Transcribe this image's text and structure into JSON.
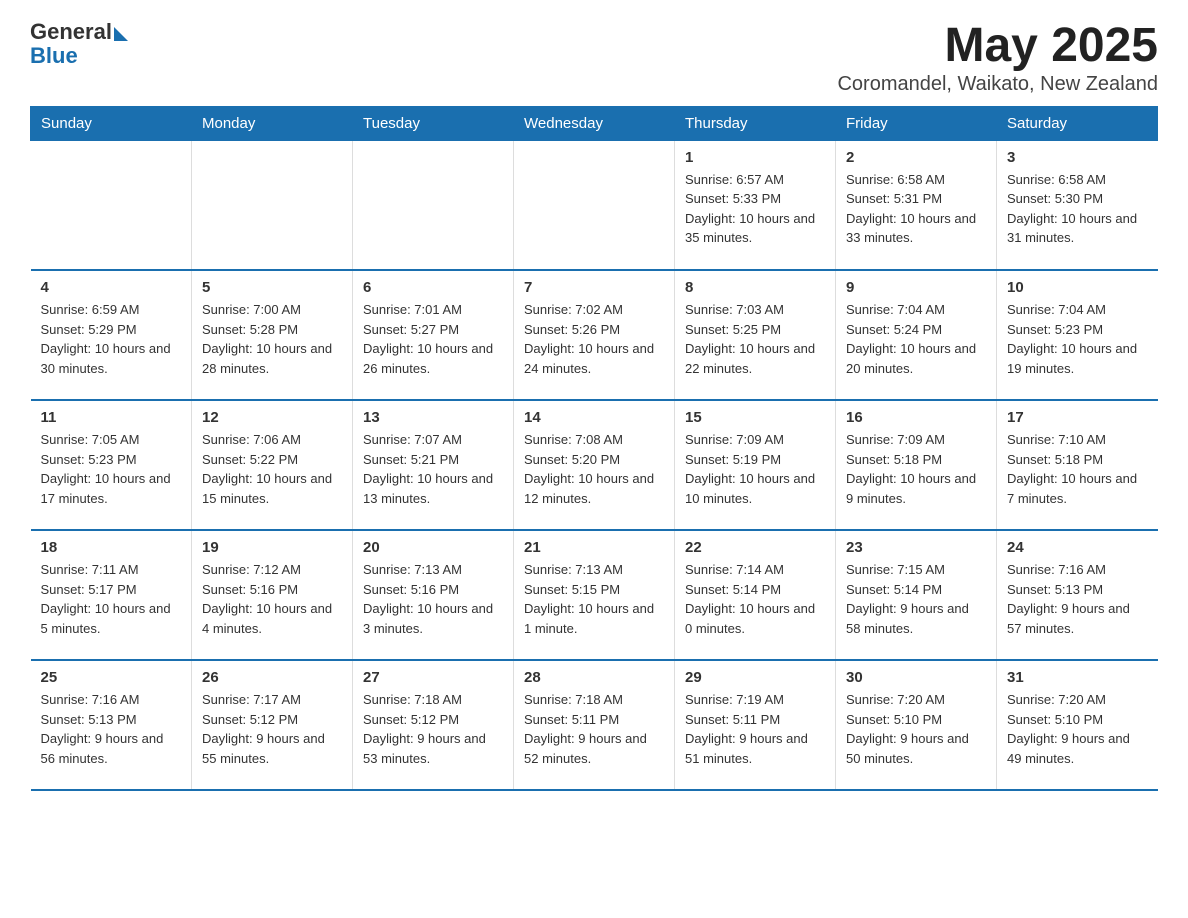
{
  "header": {
    "logo_general": "General",
    "logo_blue": "Blue",
    "title": "May 2025",
    "subtitle": "Coromandel, Waikato, New Zealand"
  },
  "weekdays": [
    "Sunday",
    "Monday",
    "Tuesday",
    "Wednesday",
    "Thursday",
    "Friday",
    "Saturday"
  ],
  "weeks": [
    [
      {
        "day": "",
        "sunrise": "",
        "sunset": "",
        "daylight": ""
      },
      {
        "day": "",
        "sunrise": "",
        "sunset": "",
        "daylight": ""
      },
      {
        "day": "",
        "sunrise": "",
        "sunset": "",
        "daylight": ""
      },
      {
        "day": "",
        "sunrise": "",
        "sunset": "",
        "daylight": ""
      },
      {
        "day": "1",
        "sunrise": "Sunrise: 6:57 AM",
        "sunset": "Sunset: 5:33 PM",
        "daylight": "Daylight: 10 hours and 35 minutes."
      },
      {
        "day": "2",
        "sunrise": "Sunrise: 6:58 AM",
        "sunset": "Sunset: 5:31 PM",
        "daylight": "Daylight: 10 hours and 33 minutes."
      },
      {
        "day": "3",
        "sunrise": "Sunrise: 6:58 AM",
        "sunset": "Sunset: 5:30 PM",
        "daylight": "Daylight: 10 hours and 31 minutes."
      }
    ],
    [
      {
        "day": "4",
        "sunrise": "Sunrise: 6:59 AM",
        "sunset": "Sunset: 5:29 PM",
        "daylight": "Daylight: 10 hours and 30 minutes."
      },
      {
        "day": "5",
        "sunrise": "Sunrise: 7:00 AM",
        "sunset": "Sunset: 5:28 PM",
        "daylight": "Daylight: 10 hours and 28 minutes."
      },
      {
        "day": "6",
        "sunrise": "Sunrise: 7:01 AM",
        "sunset": "Sunset: 5:27 PM",
        "daylight": "Daylight: 10 hours and 26 minutes."
      },
      {
        "day": "7",
        "sunrise": "Sunrise: 7:02 AM",
        "sunset": "Sunset: 5:26 PM",
        "daylight": "Daylight: 10 hours and 24 minutes."
      },
      {
        "day": "8",
        "sunrise": "Sunrise: 7:03 AM",
        "sunset": "Sunset: 5:25 PM",
        "daylight": "Daylight: 10 hours and 22 minutes."
      },
      {
        "day": "9",
        "sunrise": "Sunrise: 7:04 AM",
        "sunset": "Sunset: 5:24 PM",
        "daylight": "Daylight: 10 hours and 20 minutes."
      },
      {
        "day": "10",
        "sunrise": "Sunrise: 7:04 AM",
        "sunset": "Sunset: 5:23 PM",
        "daylight": "Daylight: 10 hours and 19 minutes."
      }
    ],
    [
      {
        "day": "11",
        "sunrise": "Sunrise: 7:05 AM",
        "sunset": "Sunset: 5:23 PM",
        "daylight": "Daylight: 10 hours and 17 minutes."
      },
      {
        "day": "12",
        "sunrise": "Sunrise: 7:06 AM",
        "sunset": "Sunset: 5:22 PM",
        "daylight": "Daylight: 10 hours and 15 minutes."
      },
      {
        "day": "13",
        "sunrise": "Sunrise: 7:07 AM",
        "sunset": "Sunset: 5:21 PM",
        "daylight": "Daylight: 10 hours and 13 minutes."
      },
      {
        "day": "14",
        "sunrise": "Sunrise: 7:08 AM",
        "sunset": "Sunset: 5:20 PM",
        "daylight": "Daylight: 10 hours and 12 minutes."
      },
      {
        "day": "15",
        "sunrise": "Sunrise: 7:09 AM",
        "sunset": "Sunset: 5:19 PM",
        "daylight": "Daylight: 10 hours and 10 minutes."
      },
      {
        "day": "16",
        "sunrise": "Sunrise: 7:09 AM",
        "sunset": "Sunset: 5:18 PM",
        "daylight": "Daylight: 10 hours and 9 minutes."
      },
      {
        "day": "17",
        "sunrise": "Sunrise: 7:10 AM",
        "sunset": "Sunset: 5:18 PM",
        "daylight": "Daylight: 10 hours and 7 minutes."
      }
    ],
    [
      {
        "day": "18",
        "sunrise": "Sunrise: 7:11 AM",
        "sunset": "Sunset: 5:17 PM",
        "daylight": "Daylight: 10 hours and 5 minutes."
      },
      {
        "day": "19",
        "sunrise": "Sunrise: 7:12 AM",
        "sunset": "Sunset: 5:16 PM",
        "daylight": "Daylight: 10 hours and 4 minutes."
      },
      {
        "day": "20",
        "sunrise": "Sunrise: 7:13 AM",
        "sunset": "Sunset: 5:16 PM",
        "daylight": "Daylight: 10 hours and 3 minutes."
      },
      {
        "day": "21",
        "sunrise": "Sunrise: 7:13 AM",
        "sunset": "Sunset: 5:15 PM",
        "daylight": "Daylight: 10 hours and 1 minute."
      },
      {
        "day": "22",
        "sunrise": "Sunrise: 7:14 AM",
        "sunset": "Sunset: 5:14 PM",
        "daylight": "Daylight: 10 hours and 0 minutes."
      },
      {
        "day": "23",
        "sunrise": "Sunrise: 7:15 AM",
        "sunset": "Sunset: 5:14 PM",
        "daylight": "Daylight: 9 hours and 58 minutes."
      },
      {
        "day": "24",
        "sunrise": "Sunrise: 7:16 AM",
        "sunset": "Sunset: 5:13 PM",
        "daylight": "Daylight: 9 hours and 57 minutes."
      }
    ],
    [
      {
        "day": "25",
        "sunrise": "Sunrise: 7:16 AM",
        "sunset": "Sunset: 5:13 PM",
        "daylight": "Daylight: 9 hours and 56 minutes."
      },
      {
        "day": "26",
        "sunrise": "Sunrise: 7:17 AM",
        "sunset": "Sunset: 5:12 PM",
        "daylight": "Daylight: 9 hours and 55 minutes."
      },
      {
        "day": "27",
        "sunrise": "Sunrise: 7:18 AM",
        "sunset": "Sunset: 5:12 PM",
        "daylight": "Daylight: 9 hours and 53 minutes."
      },
      {
        "day": "28",
        "sunrise": "Sunrise: 7:18 AM",
        "sunset": "Sunset: 5:11 PM",
        "daylight": "Daylight: 9 hours and 52 minutes."
      },
      {
        "day": "29",
        "sunrise": "Sunrise: 7:19 AM",
        "sunset": "Sunset: 5:11 PM",
        "daylight": "Daylight: 9 hours and 51 minutes."
      },
      {
        "day": "30",
        "sunrise": "Sunrise: 7:20 AM",
        "sunset": "Sunset: 5:10 PM",
        "daylight": "Daylight: 9 hours and 50 minutes."
      },
      {
        "day": "31",
        "sunrise": "Sunrise: 7:20 AM",
        "sunset": "Sunset: 5:10 PM",
        "daylight": "Daylight: 9 hours and 49 minutes."
      }
    ]
  ]
}
